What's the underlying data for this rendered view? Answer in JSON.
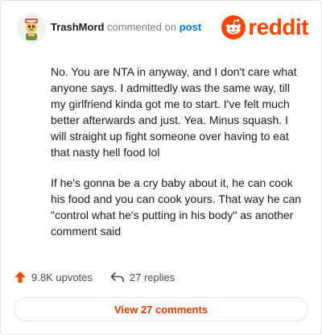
{
  "header": {
    "username": "TrashMord",
    "action_text": "commented on",
    "link_text": "post",
    "logo_text": "reddit",
    "logo_icon": "reddit-snoo-icon"
  },
  "comment": {
    "paragraphs": [
      "No. You are NTA in anyway, and I don't care what anyone says. I admittedly was the same way, till my girlfriend kinda got me to start. I've felt much better afterwards and just. Yea. Minus squash. I will straight up fight someone over having to eat that nasty hell food lol",
      "If he's gonna be a cry baby about it, he can cook his food and you can cook yours. That way he can \"control what he's putting in his body\" as another comment said"
    ]
  },
  "footer": {
    "upvotes": "9.8K upvotes",
    "replies": "27 replies",
    "view_button": "View 27 comments"
  },
  "colors": {
    "brand": "#ff4500",
    "link": "#0079d3",
    "button_text": "#d93a00"
  }
}
